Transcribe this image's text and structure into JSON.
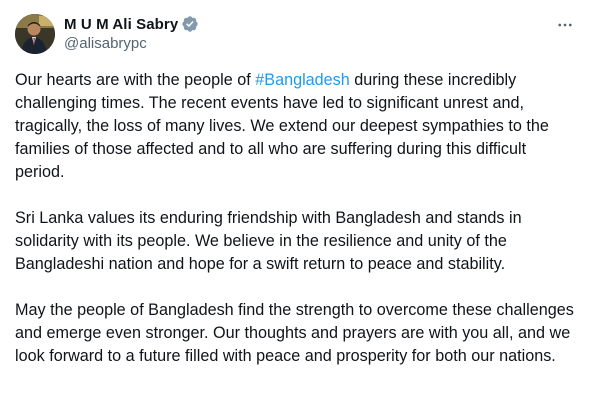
{
  "author": {
    "display_name": "M U M Ali Sabry",
    "handle": "@alisabrypc",
    "verified_icon": "verified-badge-icon",
    "verified_color": "#829aab"
  },
  "actions": {
    "more_icon": "more-horizontal-icon"
  },
  "tweet": {
    "p1_before": "Our hearts are with the people of ",
    "hashtag": "#Bangladesh",
    "p1_after": " during these incredibly challenging times. The recent events have led to significant unrest and, tragically, the loss of many lives. We extend our deepest sympathies to the families of those affected and to all who are suffering during this difficult period.",
    "p2": "Sri Lanka values its enduring friendship with Bangladesh and stands in solidarity with its people. We believe in the resilience and unity of the Bangladeshi nation and hope for a swift return to peace and stability.",
    "p3": "May the people of Bangladesh find the strength to overcome these challenges and emerge even stronger. Our thoughts and prayers are with you all, and we look forward to a future filled with peace and prosperity for both our nations."
  },
  "colors": {
    "text": "#0f1419",
    "secondary": "#536471",
    "link": "#1d9bf0"
  }
}
